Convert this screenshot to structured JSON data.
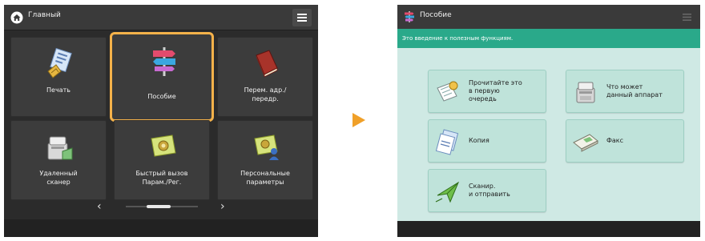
{
  "left_screen": {
    "header": {
      "title": "Главный",
      "icon": "home-icon",
      "menu_icon": "menu-icon"
    },
    "tiles": [
      {
        "label": "Печать",
        "icon": "print-icon"
      },
      {
        "label": "Пособие",
        "icon": "signpost-icon",
        "selected": true
      },
      {
        "label": "Перем. адр./\nпередр.",
        "icon": "book-icon"
      },
      {
        "label": "Удаленный\nсканер",
        "icon": "remote-scanner-icon"
      },
      {
        "label": "Быстрый вызов\nПарам./Рег.",
        "icon": "quick-settings-icon"
      },
      {
        "label": "Персональные\nпараметры",
        "icon": "personal-settings-icon"
      }
    ],
    "pager": {
      "prev": "‹",
      "next": "›"
    },
    "highlight_color": "#f5b24a"
  },
  "arrow": {
    "color": "#f0a029"
  },
  "right_screen": {
    "header": {
      "title": "Пособие",
      "icon": "signpost-icon",
      "menu_icon": "menu-icon"
    },
    "intro": "Это введение к полезным функциям.",
    "buttons": [
      {
        "label": "Прочитайте это\nв первую\nочередь",
        "icon": "document-icon"
      },
      {
        "label": "Что может\nданный аппарат",
        "icon": "printer-device-icon"
      },
      {
        "label": "Копия",
        "icon": "copy-icon"
      },
      {
        "label": "Факс",
        "icon": "fax-icon"
      },
      {
        "label": "Сканир.\nи отправить",
        "icon": "scan-send-icon"
      }
    ],
    "accent_color": "#2aa98a"
  }
}
